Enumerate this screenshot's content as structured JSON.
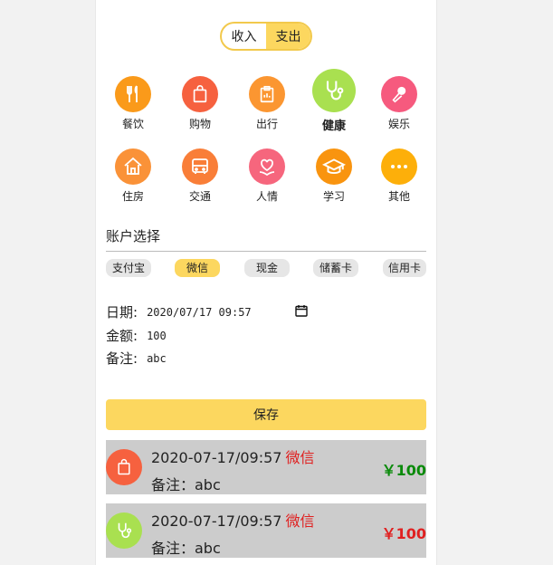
{
  "toggle": {
    "income": "收入",
    "expense": "支出",
    "active": "expense"
  },
  "categories": [
    {
      "label": "餐饮",
      "icon": "utensils-icon",
      "color": "#fa9a1a"
    },
    {
      "label": "购物",
      "icon": "shopping-bag-icon",
      "color": "#f6613f"
    },
    {
      "label": "出行",
      "icon": "clipboard-icon",
      "color": "#fb9631"
    },
    {
      "label": "健康",
      "icon": "stethoscope-icon",
      "color": "#a9e050",
      "selected": true
    },
    {
      "label": "娱乐",
      "icon": "microphone-icon",
      "color": "#f65a7e"
    },
    {
      "label": "住房",
      "icon": "house-icon",
      "color": "#fa9238"
    },
    {
      "label": "交通",
      "icon": "bus-icon",
      "color": "#f97e38"
    },
    {
      "label": "人情",
      "icon": "heart-hands-icon",
      "color": "#f6667d"
    },
    {
      "label": "学习",
      "icon": "graduation-cap-icon",
      "color": "#f9940f"
    },
    {
      "label": "其他",
      "icon": "more-icon",
      "color": "#fdaf0a"
    }
  ],
  "account": {
    "title": "账户选择",
    "options": [
      "支付宝",
      "微信",
      "现金",
      "储蓄卡",
      "信用卡"
    ],
    "selected": "微信"
  },
  "form": {
    "date_label": "日期:",
    "date_value": "2020/07/17 09:57",
    "amount_label": "金额:",
    "amount_value": "100",
    "note_label": "备注:",
    "note_value": "abc"
  },
  "save_label": "保存",
  "records": [
    {
      "datetime": "2020-07-17/09:57",
      "account": "微信",
      "note": "备注：abc",
      "amount": "￥100",
      "amount_color": "#0a8a0a",
      "icon": "shopping-bag-icon",
      "icon_color": "#f6613f"
    },
    {
      "datetime": "2020-07-17/09:57",
      "account": "微信",
      "note": "备注：abc",
      "amount": "￥100",
      "amount_color": "#e02020",
      "icon": "stethoscope-icon",
      "icon_color": "#a9e050"
    }
  ]
}
